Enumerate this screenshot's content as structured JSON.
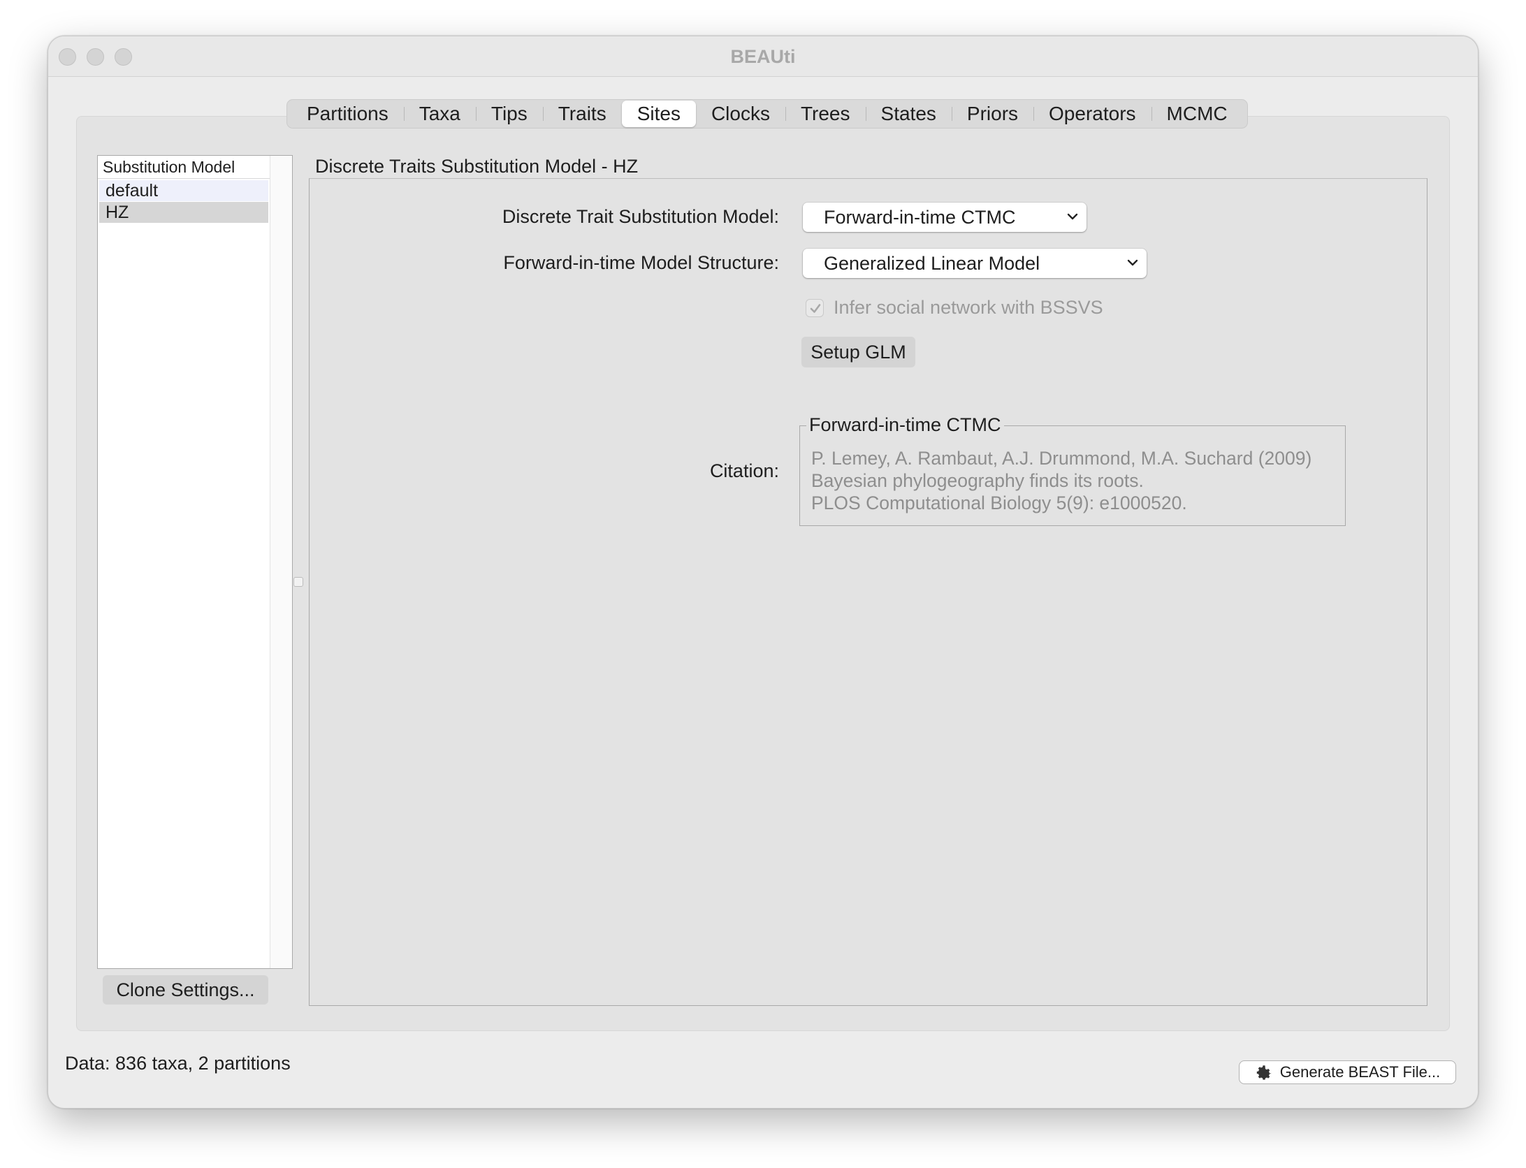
{
  "window": {
    "title": "BEAUti"
  },
  "tabs": [
    {
      "label": "Partitions"
    },
    {
      "label": "Taxa"
    },
    {
      "label": "Tips"
    },
    {
      "label": "Traits"
    },
    {
      "label": "Sites",
      "active": true
    },
    {
      "label": "Clocks"
    },
    {
      "label": "Trees"
    },
    {
      "label": "States"
    },
    {
      "label": "Priors"
    },
    {
      "label": "Operators"
    },
    {
      "label": "MCMC"
    }
  ],
  "sidebar": {
    "header": "Substitution Model",
    "items": [
      {
        "label": "default"
      },
      {
        "label": "HZ"
      }
    ],
    "clone_button": "Clone Settings..."
  },
  "main": {
    "group_title": "Discrete Traits Substitution Model - HZ",
    "model_label": "Discrete Trait Substitution Model:",
    "model_value": "Forward-in-time CTMC",
    "structure_label": "Forward-in-time Model Structure:",
    "structure_value": "Generalized Linear Model",
    "bssvs_label": "Infer social network with BSSVS",
    "bssvs_checked": true,
    "setup_button": "Setup GLM",
    "citation_label": "Citation:",
    "citation_title": "Forward-in-time CTMC",
    "citation_lines": [
      "P. Lemey, A. Rambaut, A.J. Drummond, M.A. Suchard (2009)",
      "Bayesian phylogeography finds its roots.",
      "PLOS Computational Biology 5(9): e1000520."
    ]
  },
  "status": {
    "data_text": "Data: 836 taxa, 2 partitions",
    "generate_button": "Generate BEAST File...",
    "generate_icon": "gear-icon"
  }
}
